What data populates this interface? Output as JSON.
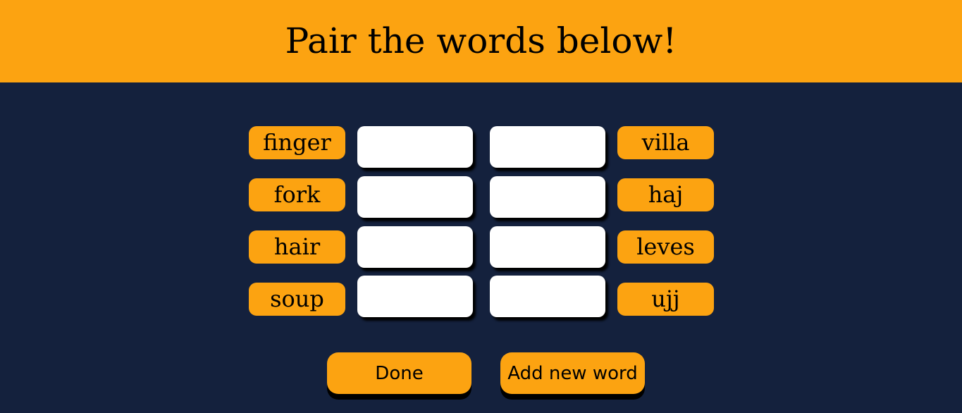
{
  "header": {
    "title": "Pair the words below!"
  },
  "left_words": [
    "finger",
    "fork",
    "hair",
    "soup"
  ],
  "right_words": [
    "villa",
    "haj",
    "leves",
    "ujj"
  ],
  "buttons": {
    "done": "Done",
    "add": "Add new word"
  },
  "colors": {
    "accent": "#fca311",
    "background": "#14213d",
    "slot": "#ffffff"
  }
}
